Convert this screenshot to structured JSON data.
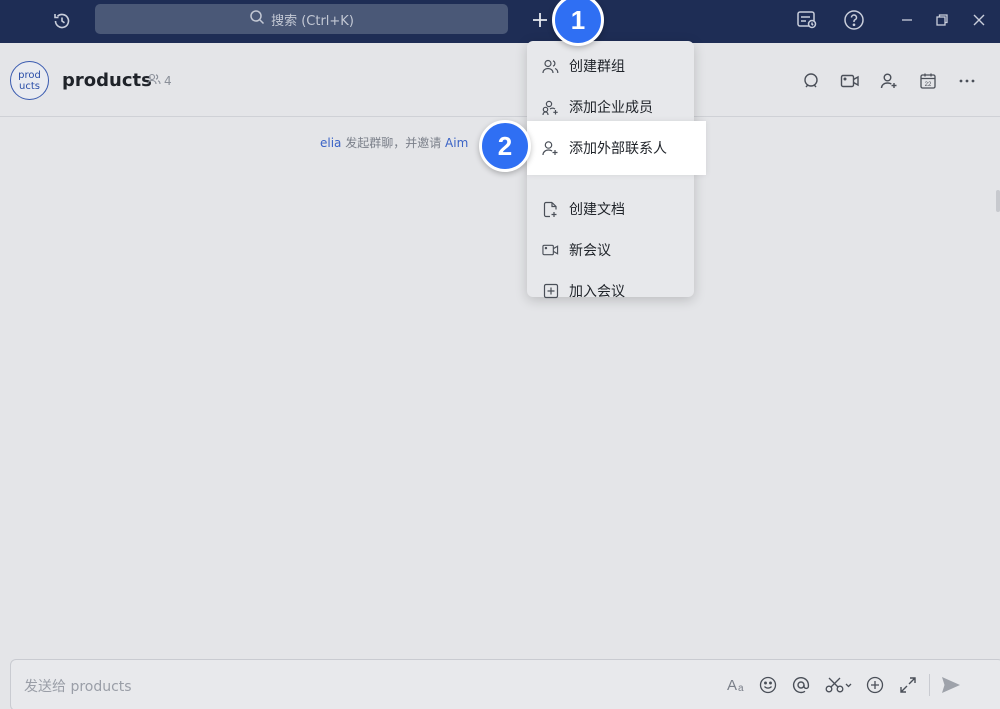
{
  "topbar": {
    "search_placeholder": "搜索 (Ctrl+K)",
    "icons": [
      "history-icon",
      "search-icon",
      "plus-icon",
      "task-icon",
      "help-icon",
      "minimize-icon",
      "restore-icon",
      "close-icon"
    ]
  },
  "chat": {
    "avatar_text": "prod ucts",
    "avatar_line1": "prod",
    "avatar_line2": "ucts",
    "title": "products",
    "member_count": "4",
    "system_message": {
      "inviter": "elia",
      "text": " 发起群聊，并邀请 ",
      "invitee": "Aim"
    }
  },
  "menu": {
    "items": [
      {
        "label": "创建群组",
        "icon": "group-icon"
      },
      {
        "label": "添加企业成员",
        "icon": "add-members-icon"
      },
      {
        "label": "添加外部联系人",
        "icon": "add-contact-icon"
      },
      {
        "label": "创建文档",
        "icon": "new-doc-icon"
      },
      {
        "label": "新会议",
        "icon": "video-icon"
      },
      {
        "label": "加入会议",
        "icon": "join-meeting-icon"
      }
    ]
  },
  "annotations": {
    "step1": "1",
    "step2": "2",
    "color": "#2f6ff3"
  },
  "composer": {
    "placeholder": "发送给 products",
    "tools": [
      "font-icon",
      "emoji-icon",
      "mention-icon",
      "scissors-icon",
      "add-icon",
      "expand-icon",
      "send-icon"
    ]
  },
  "colors": {
    "topbar": "#1e2d55",
    "accent": "#2f6ff3",
    "link": "#3a63c6"
  }
}
